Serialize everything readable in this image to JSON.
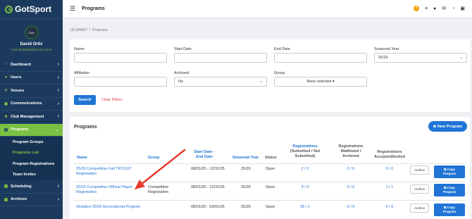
{
  "brand": {
    "name": "GotSport"
  },
  "profile": {
    "avatar_text": "Club",
    "name": "David Ortiz",
    "email": "zach.diotalevi@icloud.com",
    "email_caret": "▾"
  },
  "nav": {
    "items": [
      {
        "label": "Dashboard",
        "icon": "dashboard-icon"
      },
      {
        "label": "Users",
        "icon": "users-icon"
      },
      {
        "label": "Venues",
        "icon": "map-marker-icon"
      },
      {
        "label": "Communications",
        "icon": "chat-icon"
      },
      {
        "label": "Club Management",
        "icon": "home-icon"
      },
      {
        "label": "Programs",
        "icon": "document-icon",
        "active": true
      },
      {
        "label": "Scheduling",
        "icon": "calendar-icon"
      },
      {
        "label": "Archives",
        "icon": "archive-icon"
      }
    ],
    "sub_items": [
      {
        "label": "Program Groups"
      },
      {
        "label": "Programs List",
        "active": true
      },
      {
        "label": "Program Registrations"
      },
      {
        "label": "Team Invites"
      }
    ]
  },
  "header": {
    "title": "Programs"
  },
  "breadcrumb": {
    "id": "13L384837",
    "sep": "/",
    "current": "Programs"
  },
  "filters": {
    "name_label": "Name",
    "name_value": "",
    "start_label": "Start Date",
    "start_value": "",
    "end_label": "End Date",
    "end_value": "",
    "season_label": "Seasonal Year",
    "season_value": "25/26",
    "affiliation_label": "Affiliation",
    "affiliation_value": "",
    "archived_label": "Archived",
    "archived_value": "No",
    "group_label": "Group",
    "group_value": "None selected",
    "search_label": "Search",
    "clear_label": "Clear Filters"
  },
  "programs": {
    "title": "Programs",
    "new_label": "New Program",
    "headers": {
      "name": "Name",
      "group": "Group",
      "dates_1": "Start Date -",
      "dates_2": "End Date",
      "season": "Seasonal Year",
      "status": "Status",
      "reg_1": "Registrations",
      "reg_2": "(Submitted / Not",
      "reg_3": "Submitted)",
      "wait_1": "Registrations",
      "wait_2": "Waitlisted /",
      "wait_3": "Archived",
      "acc_1": "Registrations",
      "acc_2": "Accepted/Invited"
    },
    "rows": [
      {
        "name_1": "25/26 Competitive Fall TRYOUT",
        "name_2": "Registration",
        "group_1": "",
        "group_2": "",
        "dates": "08/01/25 - 12/31/25",
        "season": "25/26",
        "status": "Open",
        "reg": "2 / 0",
        "wait": "0 / 0",
        "acc": "0 / 0",
        "archive": "Archive",
        "copy_1": "Copy",
        "copy_2": "Program"
      },
      {
        "name_1": "25/26 Competitive Official Player",
        "name_2": "Registration",
        "group_1": "Competitive",
        "group_2": "Registration",
        "dates": "08/01/25 - 12/31/25",
        "season": "25/26",
        "status": "Open",
        "reg": "9 / 0",
        "wait": "0 / 0",
        "acc": "1 / 1",
        "archive": "Archive",
        "copy_1": "Copy",
        "copy_2": "Program"
      },
      {
        "name_1": "Diotalevi 25/26 Recreational Program",
        "name_2": "",
        "group_1": "",
        "group_2": "",
        "dates": "08/01/25 - 03/01/26",
        "season": "25/26",
        "status": "Open",
        "reg": "28 / 1",
        "wait": "0 / 0",
        "acc": "0 / 0",
        "archive": "Archive",
        "copy_1": "Copy",
        "copy_2": "Program"
      }
    ]
  },
  "annotation": {
    "arrow_color": "#e53a2a"
  },
  "colors": {
    "sidebar": "#1c3a5e",
    "accent_green": "#7ac143",
    "primary_blue": "#1f74d6",
    "danger_red": "#e04040"
  }
}
